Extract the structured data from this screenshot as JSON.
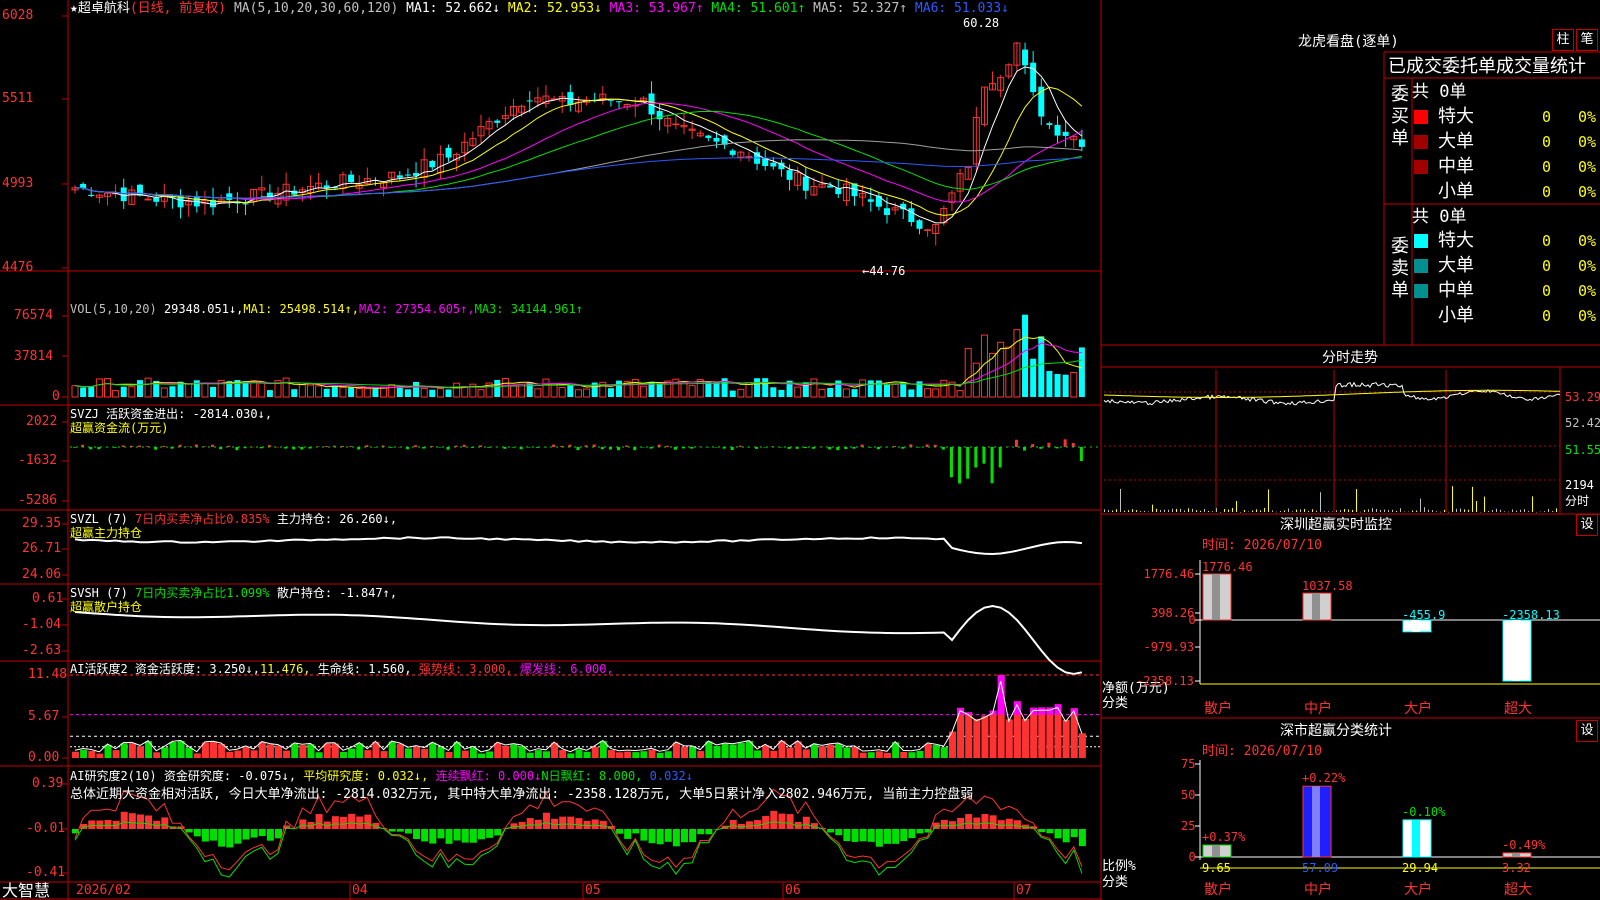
{
  "colors": {
    "up": "#ff3232",
    "down": "#00ffff",
    "border": "#c00000",
    "yellow": "#ffff00",
    "magenta": "#ff00ff",
    "green": "#00e000",
    "white": "#ffffff",
    "blue": "#0000ff"
  },
  "main": {
    "title": "★超卓航科",
    "mode": "(日线, 前复权)",
    "ma_label": "MA(5,10,20,30,60,120)",
    "ma1": "MA1: 52.662↓",
    "ma2": "MA2: 52.953↓",
    "ma3": "MA3: 53.967↑",
    "ma4": "MA4: 51.601↑",
    "ma5": "MA5: 52.327↑",
    "ma6": "MA6: 51.033↓",
    "yticks": [
      "6028",
      "5511",
      "4993",
      "4476"
    ],
    "high_label": "60.28",
    "low_label": "←44.76"
  },
  "vol": {
    "label": "VOL(5,10,20)",
    "value": "29348.051↓,",
    "ma1": "MA1: 25498.514↑,",
    "ma2": "MA2: 27354.605↑,",
    "ma3": "MA3: 34144.961↑",
    "yticks": [
      "76574",
      "37814",
      "0"
    ]
  },
  "svzj": {
    "line1": "SVZJ  活跃资金进出: -2814.030↓,",
    "line2": "超赢资金流(万元)",
    "yticks": [
      "2022",
      "-1632",
      "-5286"
    ]
  },
  "svzl": {
    "label": "SVZL (7)",
    "pct": "7日内买卖净占比0.835%",
    "hold": "主力持仓: 26.260↓,",
    "line2": "超赢主力持仓",
    "yticks": [
      "29.35",
      "26.71",
      "24.06"
    ]
  },
  "svsh": {
    "label": "SVSH (7)",
    "pct": "7日内买卖净占比1.099%",
    "hold": "散户持仓: -1.847↑,",
    "line2": "超赢散户持仓",
    "yticks": [
      "0.61",
      "-1.04",
      "-2.63"
    ]
  },
  "ai1": {
    "label": "AI活跃度2",
    "v1": "资金活跃度: 3.250↓,",
    "v2": "11.476,",
    "v3": "生命线: 1.560,",
    "v4": "强势线: 3.000,",
    "v5": "爆发线: 6.000,",
    "yticks": [
      "11.48",
      "5.67",
      "0.00"
    ]
  },
  "ai2": {
    "label": "AI研究度2(10)",
    "v1": "资金研究度: -0.075↓,",
    "v2": "平均研究度: 0.032↓,",
    "v3": "连续飘红: 0.000↓",
    "v4": "N日飘红: 8.000,",
    "v5": "0.032↓",
    "summary": "总体近期大资金相对活跃, 今日大单净流出: -2814.032万元, 其中特大单净流出: -2358.128万元, 大单5日累计净入2802.946万元, 当前主力控盘弱",
    "yticks": [
      "0.39",
      "-0.01",
      "-0.41"
    ]
  },
  "xaxis": {
    "brand": "大智慧",
    "labels": [
      "2026/02",
      "04",
      "05",
      "06",
      "07"
    ]
  },
  "longhu": {
    "title": "龙虎看盘(逐单)",
    "btn_zhu": "柱",
    "btn_bi": "笔",
    "header": "已成交委托单成交量统计",
    "buy_side": "委买单",
    "sell_side": "委卖单",
    "buy_total": "共 0单",
    "sell_total": "共 0单",
    "buy_rows": [
      {
        "name": "特大",
        "count": "0",
        "pct": "0%"
      },
      {
        "name": "大单",
        "count": "0",
        "pct": "0%"
      },
      {
        "name": "中单",
        "count": "0",
        "pct": "0%"
      },
      {
        "name": "小单",
        "count": "0",
        "pct": "0%"
      }
    ],
    "sell_rows": [
      {
        "name": "特大",
        "count": "0",
        "pct": "0%"
      },
      {
        "name": "大单",
        "count": "0",
        "pct": "0%"
      },
      {
        "name": "中单",
        "count": "0",
        "pct": "0%"
      },
      {
        "name": "小单",
        "count": "0",
        "pct": "0%"
      }
    ]
  },
  "intraday": {
    "title": "分时走势",
    "yticks": [
      "53.29",
      "52.42",
      "51.55"
    ],
    "vol_tick": "2194",
    "unit": "分时"
  },
  "sz_monitor": {
    "title": "深圳超赢实时监控",
    "btn": "设",
    "time": "时间: 2026/07/10",
    "yticks": [
      "1776.46",
      "398.26",
      "0",
      "-979.93",
      "-2358.13"
    ],
    "ylabel": "净额(万元)",
    "xlabel": "分类",
    "cats": [
      "散户",
      "中户",
      "大户",
      "超大"
    ],
    "values": [
      1776.46,
      1037.58,
      -455.9,
      -2358.13
    ],
    "value_labels": [
      "1776.46",
      "1037.58",
      "-455.9",
      "-2358.13"
    ]
  },
  "sz_class": {
    "title": "深市超赢分类统计",
    "btn": "设",
    "time": "时间: 2026/07/10",
    "yticks": [
      "75",
      "50",
      "25",
      "0"
    ],
    "ylabel": "比例%",
    "xlabel": "分类",
    "cats": [
      "散户",
      "中户",
      "大户",
      "超大"
    ],
    "values": [
      9.65,
      57.09,
      29.94,
      3.32
    ],
    "value_labels": [
      "9.65",
      "57.09",
      "29.94",
      "3.32"
    ],
    "chg_labels": [
      "+0.37%",
      "+0.22%",
      "-0.10%",
      "-0.49%"
    ]
  }
}
